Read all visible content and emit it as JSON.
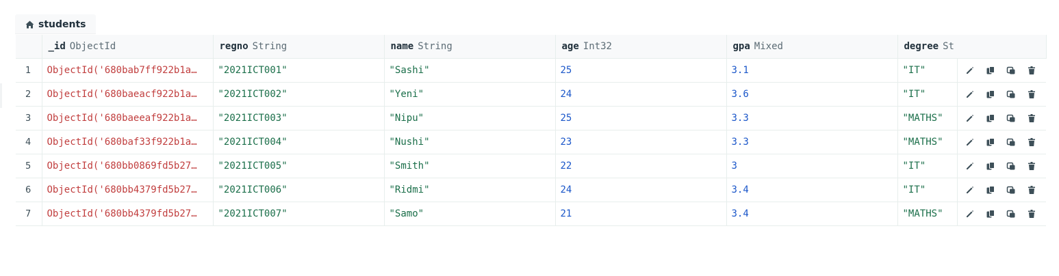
{
  "tab": {
    "label": "students",
    "icon": "home-icon"
  },
  "columns": [
    {
      "name": "_id",
      "type": "ObjectId"
    },
    {
      "name": "regno",
      "type": "String"
    },
    {
      "name": "name",
      "type": "String"
    },
    {
      "name": "age",
      "type": "Int32"
    },
    {
      "name": "gpa",
      "type": "Mixed"
    },
    {
      "name": "degree",
      "type": "St"
    }
  ],
  "rows": [
    {
      "n": "1",
      "id": "ObjectId('680bab7ff922b1a…",
      "regno": "\"2021ICT001\"",
      "name": "\"Sashi\"",
      "age": "25",
      "gpa": "3.1",
      "degree": "\"IT\""
    },
    {
      "n": "2",
      "id": "ObjectId('680baeacf922b1a…",
      "regno": "\"2021ICT002\"",
      "name": "\"Yeni\"",
      "age": "24",
      "gpa": "3.6",
      "degree": "\"IT\""
    },
    {
      "n": "3",
      "id": "ObjectId('680baeeaf922b1a…",
      "regno": "\"2021ICT003\"",
      "name": "\"Nipu\"",
      "age": "25",
      "gpa": "3.3",
      "degree": "\"MATHS\""
    },
    {
      "n": "4",
      "id": "ObjectId('680baf33f922b1a…",
      "regno": "\"2021ICT004\"",
      "name": "\"Nushi\"",
      "age": "23",
      "gpa": "3.3",
      "degree": "\"MATHS\""
    },
    {
      "n": "5",
      "id": "ObjectId('680bb0869fd5b27…",
      "regno": "\"2021ICT005\"",
      "name": "\"Smith\"",
      "age": "22",
      "gpa": "3",
      "degree": "\"IT\""
    },
    {
      "n": "6",
      "id": "ObjectId('680bb4379fd5b27…",
      "regno": "\"2021ICT006\"",
      "name": "\"Ridmi\"",
      "age": "24",
      "gpa": "3.4",
      "degree": "\"IT\""
    },
    {
      "n": "7",
      "id": "ObjectId('680bb4379fd5b27…",
      "regno": "\"2021ICT007\"",
      "name": "\"Samo\"",
      "age": "21",
      "gpa": "3.4",
      "degree": "\"MATHS\""
    }
  ],
  "row_actions": [
    "edit-icon",
    "copy-icon",
    "clone-icon",
    "delete-icon"
  ],
  "colors": {
    "objectid": "#c13e3e",
    "string": "#1a6e49",
    "number": "#1a56c9",
    "header_bg": "#f8f9fa",
    "border": "#e7eeec"
  }
}
